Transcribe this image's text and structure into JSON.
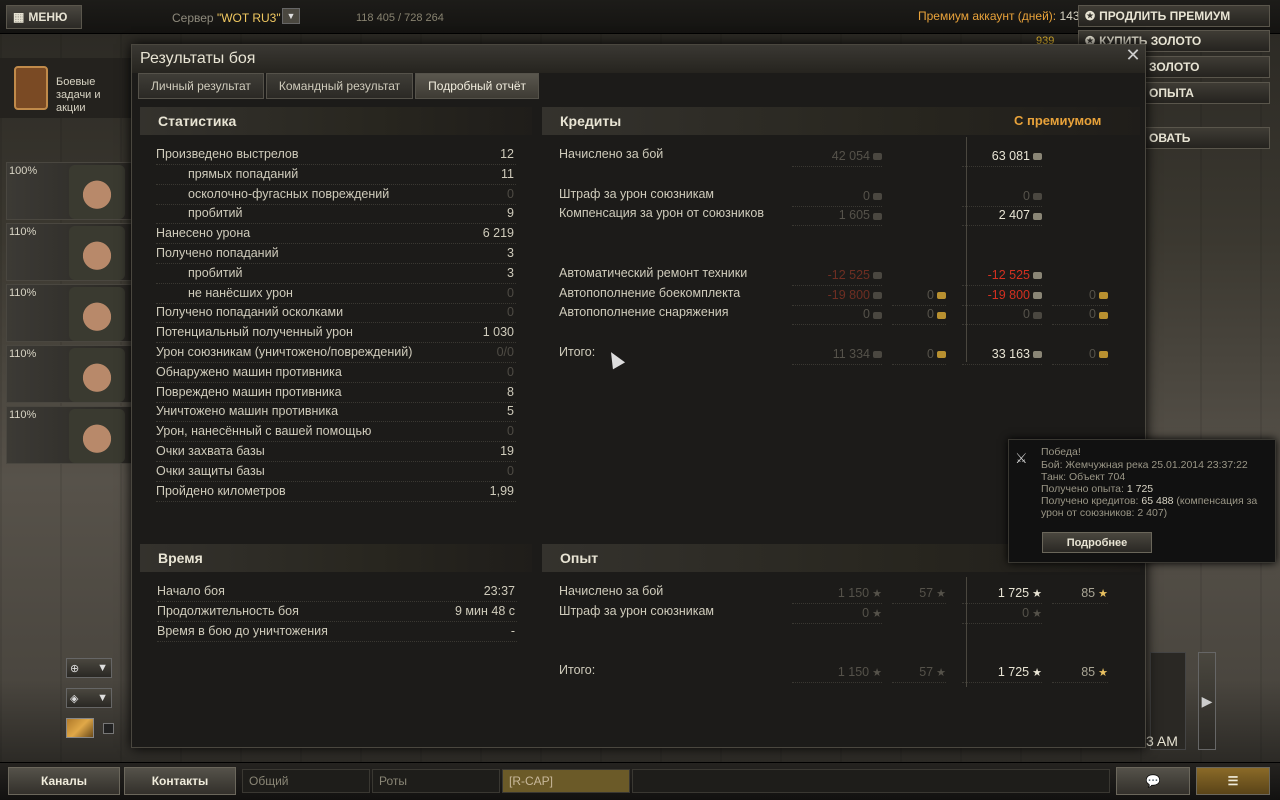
{
  "topbar": {
    "menu_label": "МЕНЮ",
    "server_prefix": "Сервер",
    "server_name": "\"WOT RU3\"",
    "online": "118 405 / 728 264",
    "premium_label": "Премиум аккаунт (дней):",
    "premium_days": "143",
    "gold_amount": "939",
    "buttons": [
      "ПРОДЛИТЬ ПРЕМИУМ",
      "КУПИТЬ ЗОЛОТО",
      "ЗОЛОТО",
      "ОПЫТА",
      "ОВАТЬ"
    ]
  },
  "left_panel": {
    "quests_label": "Боевые задачи и акции",
    "crew_percents": [
      "100%",
      "110%",
      "110%",
      "110%",
      "110%"
    ]
  },
  "dialog": {
    "title": "Результаты боя",
    "tabs": [
      "Личный результат",
      "Командный результат",
      "Подробный отчёт"
    ],
    "active_tab": 2,
    "stats": {
      "title": "Статистика",
      "rows": [
        {
          "label": "Произведено выстрелов",
          "value": "12",
          "indent": false,
          "dim": false
        },
        {
          "label": "прямых попаданий",
          "value": "11",
          "indent": true,
          "dim": false
        },
        {
          "label": "осколочно-фугасных повреждений",
          "value": "0",
          "indent": true,
          "dim": true
        },
        {
          "label": "пробитий",
          "value": "9",
          "indent": true,
          "dim": false
        },
        {
          "label": "Нанесено урона",
          "value": "6 219",
          "indent": false,
          "dim": false
        },
        {
          "label": "Получено попаданий",
          "value": "3",
          "indent": false,
          "dim": false
        },
        {
          "label": "пробитий",
          "value": "3",
          "indent": true,
          "dim": false
        },
        {
          "label": "не нанёсших урон",
          "value": "0",
          "indent": true,
          "dim": true
        },
        {
          "label": "Получено попаданий осколками",
          "value": "0",
          "indent": false,
          "dim": true
        },
        {
          "label": "Потенциальный полученный урон",
          "value": "1 030",
          "indent": false,
          "dim": false
        },
        {
          "label": "Урон союзникам (уничтожено/повреждений)",
          "value": "0/0",
          "indent": false,
          "dim": true
        },
        {
          "label": "Обнаружено машин противника",
          "value": "0",
          "indent": false,
          "dim": true
        },
        {
          "label": "Повреждено машин противника",
          "value": "8",
          "indent": false,
          "dim": false
        },
        {
          "label": "Уничтожено машин противника",
          "value": "5",
          "indent": false,
          "dim": false
        },
        {
          "label": "Урон, нанесённый с вашей помощью",
          "value": "0",
          "indent": false,
          "dim": true
        },
        {
          "label": "Очки захвата базы",
          "value": "19",
          "indent": false,
          "dim": false
        },
        {
          "label": "Очки защиты базы",
          "value": "0",
          "indent": false,
          "dim": true
        },
        {
          "label": "Пройдено километров",
          "value": "1,99",
          "indent": false,
          "dim": false
        }
      ]
    },
    "time": {
      "title": "Время",
      "rows": [
        {
          "label": "Начало боя",
          "value": "23:37"
        },
        {
          "label": "Продолжительность боя",
          "value": "9 мин 48 с"
        },
        {
          "label": "Время в бою до уничтожения",
          "value": "-"
        }
      ]
    },
    "credits": {
      "title": "Кредиты",
      "premium_title": "С премиумом",
      "rows": [
        {
          "label": "Начислено за бой",
          "base": "42 054",
          "base_gold": "",
          "prem": "63 081",
          "prem_gold": "",
          "red": false,
          "slot": 0
        },
        {
          "label": "Штраф за урон союзникам",
          "base": "0",
          "base_gold": "",
          "prem": "0",
          "prem_gold": "",
          "red": false,
          "slot": 2
        },
        {
          "label": "Компенсация за урон от союзников",
          "base": "1 605",
          "base_gold": "",
          "prem": "2 407",
          "prem_gold": "",
          "red": false,
          "slot": 3
        },
        {
          "label": "Автоматический ремонт техники",
          "base": "-12 525",
          "base_gold": "",
          "prem": "-12 525",
          "prem_gold": "",
          "red": true,
          "slot": 6
        },
        {
          "label": "Автопополнение боекомплекта",
          "base": "-19 800",
          "base_gold": "0",
          "prem": "-19 800",
          "prem_gold": "0",
          "red": true,
          "slot": 7
        },
        {
          "label": "Автопополнение снаряжения",
          "base": "0",
          "base_gold": "0",
          "prem": "0",
          "prem_gold": "0",
          "red": false,
          "slot": 8
        },
        {
          "label": "Итого:",
          "base": "11 334",
          "base_gold": "0",
          "prem": "33 163",
          "prem_gold": "0",
          "red": false,
          "slot": 10
        }
      ]
    },
    "experience": {
      "title": "Опыт",
      "rows": [
        {
          "label": "Начислено за бой",
          "base": "1 150",
          "base_free": "57",
          "prem": "1 725",
          "prem_free": "85",
          "slot": 0
        },
        {
          "label": "Штраф за урон союзникам",
          "base": "0",
          "base_free": "",
          "prem": "0",
          "prem_free": "",
          "slot": 1
        },
        {
          "label": "Итого:",
          "base": "1 150",
          "base_free": "57",
          "prem": "1 725",
          "prem_free": "85",
          "slot": 4
        }
      ]
    }
  },
  "notification": {
    "title": "Победа!",
    "battle": "Бой: Жемчужная река 25.01.2014 23:37:22",
    "tank": "Танк: Объект 704",
    "xp_prefix": "Получено опыта: ",
    "xp_value": "1 725",
    "credits_prefix": "Получено кредитов: ",
    "credits_value": "65 488",
    "credits_suffix": " (компенсация за",
    "credits_line2": "урон от союзников: 2 407)",
    "button": "Подробнее"
  },
  "bottombar": {
    "channels_label": "Каналы",
    "contacts_label": "Контакты",
    "chat_tabs": [
      "Общий",
      "Роты",
      "[R-CAP]"
    ],
    "clock": "3 AM"
  }
}
